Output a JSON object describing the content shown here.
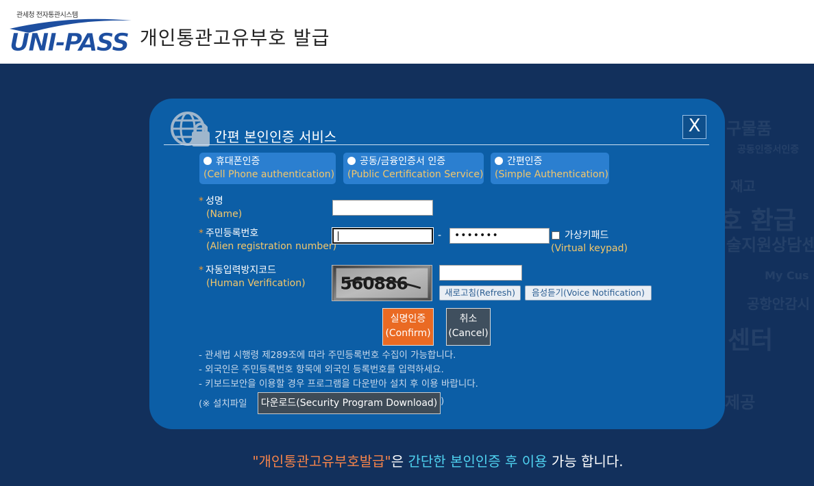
{
  "header": {
    "logo_small": "관세청 전자통관시스템",
    "logo_main": "UNI-PASS",
    "title": "개인통관고유부호 발급"
  },
  "background_words": [
    "구물품",
    "공동인증서인증",
    "재고",
    "호 환급",
    "술지원상담센",
    "My Cus",
    "공항안감시",
    "센터",
    "제공"
  ],
  "modal": {
    "title": "간편 본인인증 서비스",
    "close_label": "X",
    "auth_options": [
      {
        "label": "휴대폰인증",
        "label_en": "(Cell Phone authentication)"
      },
      {
        "label": "공동/금융인증서 인증",
        "label_en": "(Public Certification Service)"
      },
      {
        "label": "간편인증",
        "label_en": "(Simple Authentication)"
      }
    ],
    "fields": {
      "name": {
        "required_mark": "*",
        "label": "성명",
        "label_en": "(Name)",
        "value": ""
      },
      "regno": {
        "required_mark": "*",
        "label": "주민등록번호",
        "label_en": "(Alien registration number)",
        "value_front": "",
        "separator": "-",
        "value_back_masked": "•••••••"
      },
      "captcha": {
        "required_mark": "*",
        "label": "자동입력방지코드",
        "label_en": "(Human Verification)",
        "code_image_text": "560886",
        "value": ""
      }
    },
    "virtual_keypad": {
      "label": "가상키패드",
      "label_en": "(Virtual keypad)",
      "checked": false
    },
    "refresh_label": "새로고침(Refresh)",
    "voice_label": "음성듣기(Voice Notification)",
    "confirm": {
      "label": "실명인증",
      "label_en": "(Confirm)"
    },
    "cancel": {
      "label": "취소",
      "label_en": "(Cancel)"
    },
    "notices": [
      "- 관세법 시행령 제289조에 따라 주민등록번호 수집이 가능합니다.",
      "- 외국인은 주민등록번호 항목에 외국인 등록번호를 입력하세요.",
      "- 키보드보안을 이용할 경우 프로그램을 다운받아 설치 후 이용 바랍니다."
    ],
    "install_prefix": "(※ 설치파일",
    "download_label": "다운로드(Security Program Download)",
    "install_suffix": ")"
  },
  "bottom_message": {
    "part1": "\"개인통관고유부호발급\"",
    "part2": "은 ",
    "part3": "간단한 본인인증 후 이용",
    "part4": " 가능 합니다."
  },
  "colors": {
    "background": "#12305c",
    "modal": "#0c5ea6",
    "tab": "#2b7fd0",
    "accent_orange": "#ea6a23",
    "english_label": "#f4c76a",
    "cyan_text": "#4fd2f0"
  }
}
